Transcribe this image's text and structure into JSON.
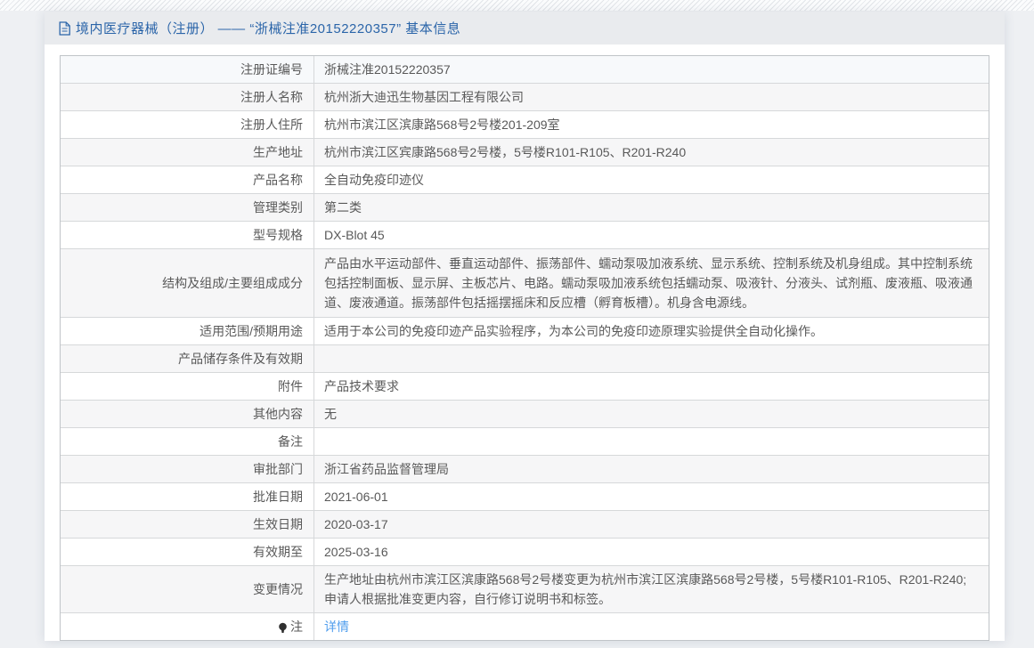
{
  "page": {
    "title": "境内医疗器械（注册） —— “浙械注准20152220357” 基本信息"
  },
  "colors": {
    "title_blue": "#2b65a9",
    "link_blue": "#4f9ded",
    "stripe_gray": "#f6f6f7",
    "titlebar_gray": "#e9ebee"
  },
  "icons": {
    "title_icon": "document-icon",
    "note_icon": "bulb-icon"
  },
  "table": {
    "rows": [
      {
        "label": "注册证编号",
        "value": "浙械注准20152220357"
      },
      {
        "label": "注册人名称",
        "value": "杭州浙大迪迅生物基因工程有限公司"
      },
      {
        "label": "注册人住所",
        "value": "杭州市滨江区滨康路568号2号楼201-209室"
      },
      {
        "label": "生产地址",
        "value": "杭州市滨江区宾康路568号2号楼，5号楼R101-R105、R201-R240"
      },
      {
        "label": "产品名称",
        "value": "全自动免疫印迹仪"
      },
      {
        "label": "管理类别",
        "value": "第二类"
      },
      {
        "label": "型号规格",
        "value": "DX-Blot 45"
      },
      {
        "label": "结构及组成/主要组成成分",
        "value": "产品由水平运动部件、垂直运动部件、振荡部件、蠕动泵吸加液系统、显示系统、控制系统及机身组成。其中控制系统包括控制面板、显示屏、主板芯片、电路。蠕动泵吸加液系统包括蠕动泵、吸液针、分液头、试剂瓶、废液瓶、吸液通道、废液通道。振荡部件包括摇摆摇床和反应槽（孵育板槽）。机身含电源线。"
      },
      {
        "label": "适用范围/预期用途",
        "value": "适用于本公司的免疫印迹产品实验程序，为本公司的免疫印迹原理实验提供全自动化操作。"
      },
      {
        "label": "产品储存条件及有效期",
        "value": ""
      },
      {
        "label": "附件",
        "value": "产品技术要求"
      },
      {
        "label": "其他内容",
        "value": "无"
      },
      {
        "label": "备注",
        "value": ""
      },
      {
        "label": "审批部门",
        "value": "浙江省药品监督管理局"
      },
      {
        "label": "批准日期",
        "value": "2021-06-01"
      },
      {
        "label": "生效日期",
        "value": "2020-03-17"
      },
      {
        "label": "有效期至",
        "value": "2025-03-16"
      },
      {
        "label": "变更情况",
        "value": "生产地址由杭州市滨江区滨康路568号2号楼变更为杭州市滨江区滨康路568号2号楼，5号楼R101-R105、R201-R240;申请人根据批准变更内容，自行修订说明书和标签。"
      }
    ],
    "note_label": "注",
    "note_link": "详情"
  }
}
